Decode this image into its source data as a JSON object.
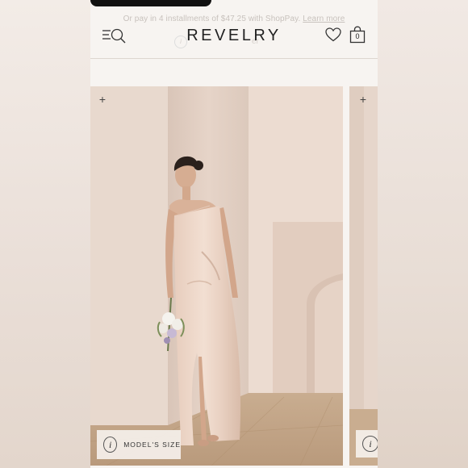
{
  "banner": {
    "text": "Or pay in 4 installments of $47.25 with ShopPay.",
    "link": "Learn more"
  },
  "header": {
    "logo": "REVELRY",
    "ghost_text": "er",
    "bag_count": "0"
  },
  "gallery": {
    "model_size_label": "MODEL'S SIZE",
    "info_glyph": "i",
    "plus_glyph": "+"
  },
  "icons": [
    "menu-search-icon",
    "heart-icon",
    "bag-icon",
    "plus-icon",
    "info-icon"
  ]
}
